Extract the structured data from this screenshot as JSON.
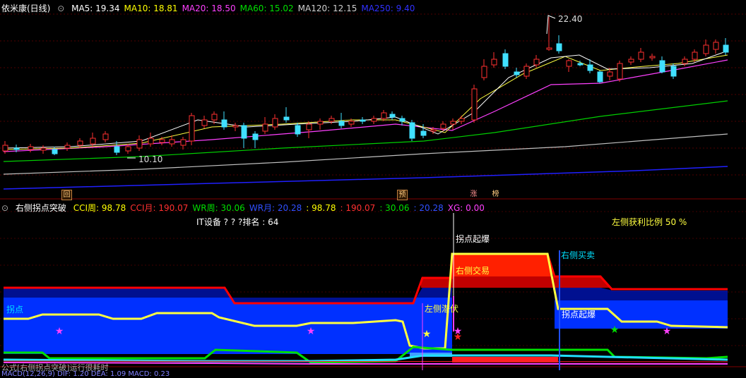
{
  "main": {
    "title": "依米康(日线)",
    "ma": [
      {
        "label": "MA5: 19.34",
        "color": "#ffffff"
      },
      {
        "label": "MA10: 18.81",
        "color": "#ffff00"
      },
      {
        "label": "MA20: 18.50",
        "color": "#ff40ff"
      },
      {
        "label": "MA60: 15.02",
        "color": "#00e000"
      },
      {
        "label": "MA120: 12.15",
        "color": "#d0d0d0"
      },
      {
        "label": "MA250: 9.40",
        "color": "#3030ff"
      }
    ],
    "high_label": "22.40",
    "low_label": "10.10",
    "markers": [
      "回",
      "预",
      "涨",
      "榜"
    ]
  },
  "indicator": {
    "title": "右侧拐点突破",
    "values": [
      {
        "label": "CCI周: 98.78",
        "color": "#ffff00"
      },
      {
        "label": "CCI月: 190.07",
        "color": "#ff3030"
      },
      {
        "label": "WR周: 30.06",
        "color": "#00e000"
      },
      {
        "label": "WR月: 20.28",
        "color": "#3050ff"
      },
      {
        "label": ": 98.78",
        "color": "#ffff00"
      },
      {
        "label": ": 190.07",
        "color": "#ff3030"
      },
      {
        "label": ": 30.06",
        "color": "#00e000"
      },
      {
        "label": ": 20.28",
        "color": "#3050ff"
      },
      {
        "label": "XG: 0.00",
        "color": "#ff40ff"
      }
    ],
    "rank_text": "IT设备 ? ? ?排名 : 64",
    "profit_text": "左侧获利比例 50 %",
    "labels": {
      "guaidian": "拐点",
      "guaidian_qibao": "拐点起爆",
      "youce_jiaoyi": "右侧交易",
      "youce_maimai": "右侧买卖",
      "zuoce_qianfu": "左侧潜伏",
      "guaidian_qibao2": "拐点起爆"
    },
    "footer_formula": "公式[右侧拐点突破]运行很耗时",
    "footer_macd": "MACD(12,26,9)  DIF: 1.20  DEA: 1.09  MACD: 0.23"
  }
}
